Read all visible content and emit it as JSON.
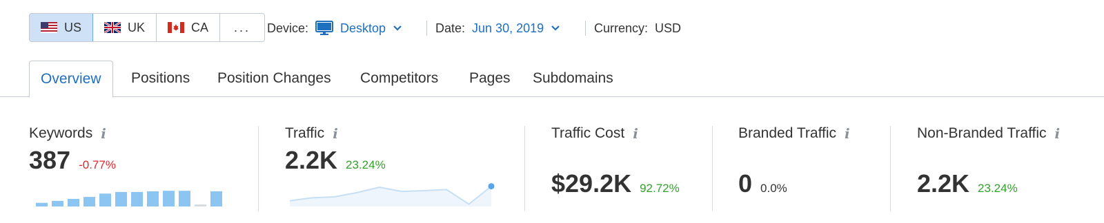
{
  "countries": [
    {
      "code": "US",
      "icon": "us-flag-icon",
      "active": true
    },
    {
      "code": "UK",
      "icon": "uk-flag-icon",
      "active": false
    },
    {
      "code": "CA",
      "icon": "ca-flag-icon",
      "active": false
    },
    {
      "code": "...",
      "icon": "",
      "active": false
    }
  ],
  "filters": {
    "device_label": "Device:",
    "device_value": "Desktop",
    "device_icon": "monitor-icon",
    "date_label": "Date:",
    "date_value": "Jun 30, 2019",
    "currency_label": "Currency:",
    "currency_value": "USD"
  },
  "tabs": [
    {
      "label": "Overview",
      "active": true
    },
    {
      "label": "Positions"
    },
    {
      "label": "Position Changes"
    },
    {
      "label": "Competitors"
    },
    {
      "label": "Pages"
    },
    {
      "label": "Subdomains"
    }
  ],
  "metrics": [
    {
      "title": "Keywords",
      "value": "387",
      "change": "-0.77%",
      "change_tone": "negative",
      "bars": [
        0.22,
        0.34,
        0.46,
        0.58,
        0.78,
        0.88,
        0.88,
        0.92,
        0.95,
        0.95,
        0.12,
        0.92
      ]
    },
    {
      "title": "Traffic",
      "value": "2.2K",
      "change": "23.24%",
      "change_tone": "positive",
      "sparkline": [
        0.3,
        0.45,
        0.5,
        0.72,
        1.0,
        0.78,
        0.82,
        0.88,
        0.12,
        1.05
      ]
    },
    {
      "title": "Traffic Cost",
      "value": "$29.2K",
      "change": "92.72%",
      "change_tone": "positive"
    },
    {
      "title": "Branded Traffic",
      "value": "0",
      "change": "0.0%",
      "change_tone": "neutral"
    },
    {
      "title": "Non-Branded Traffic",
      "value": "2.2K",
      "change": "23.24%",
      "change_tone": "positive"
    }
  ],
  "colors": {
    "accent": "#1f6fbf",
    "positive": "#33a02c",
    "negative": "#e0262b",
    "bar": "#8cc4f2",
    "bar_muted": "#d5dadf",
    "active_tab_bg": "#cfe1f6"
  }
}
